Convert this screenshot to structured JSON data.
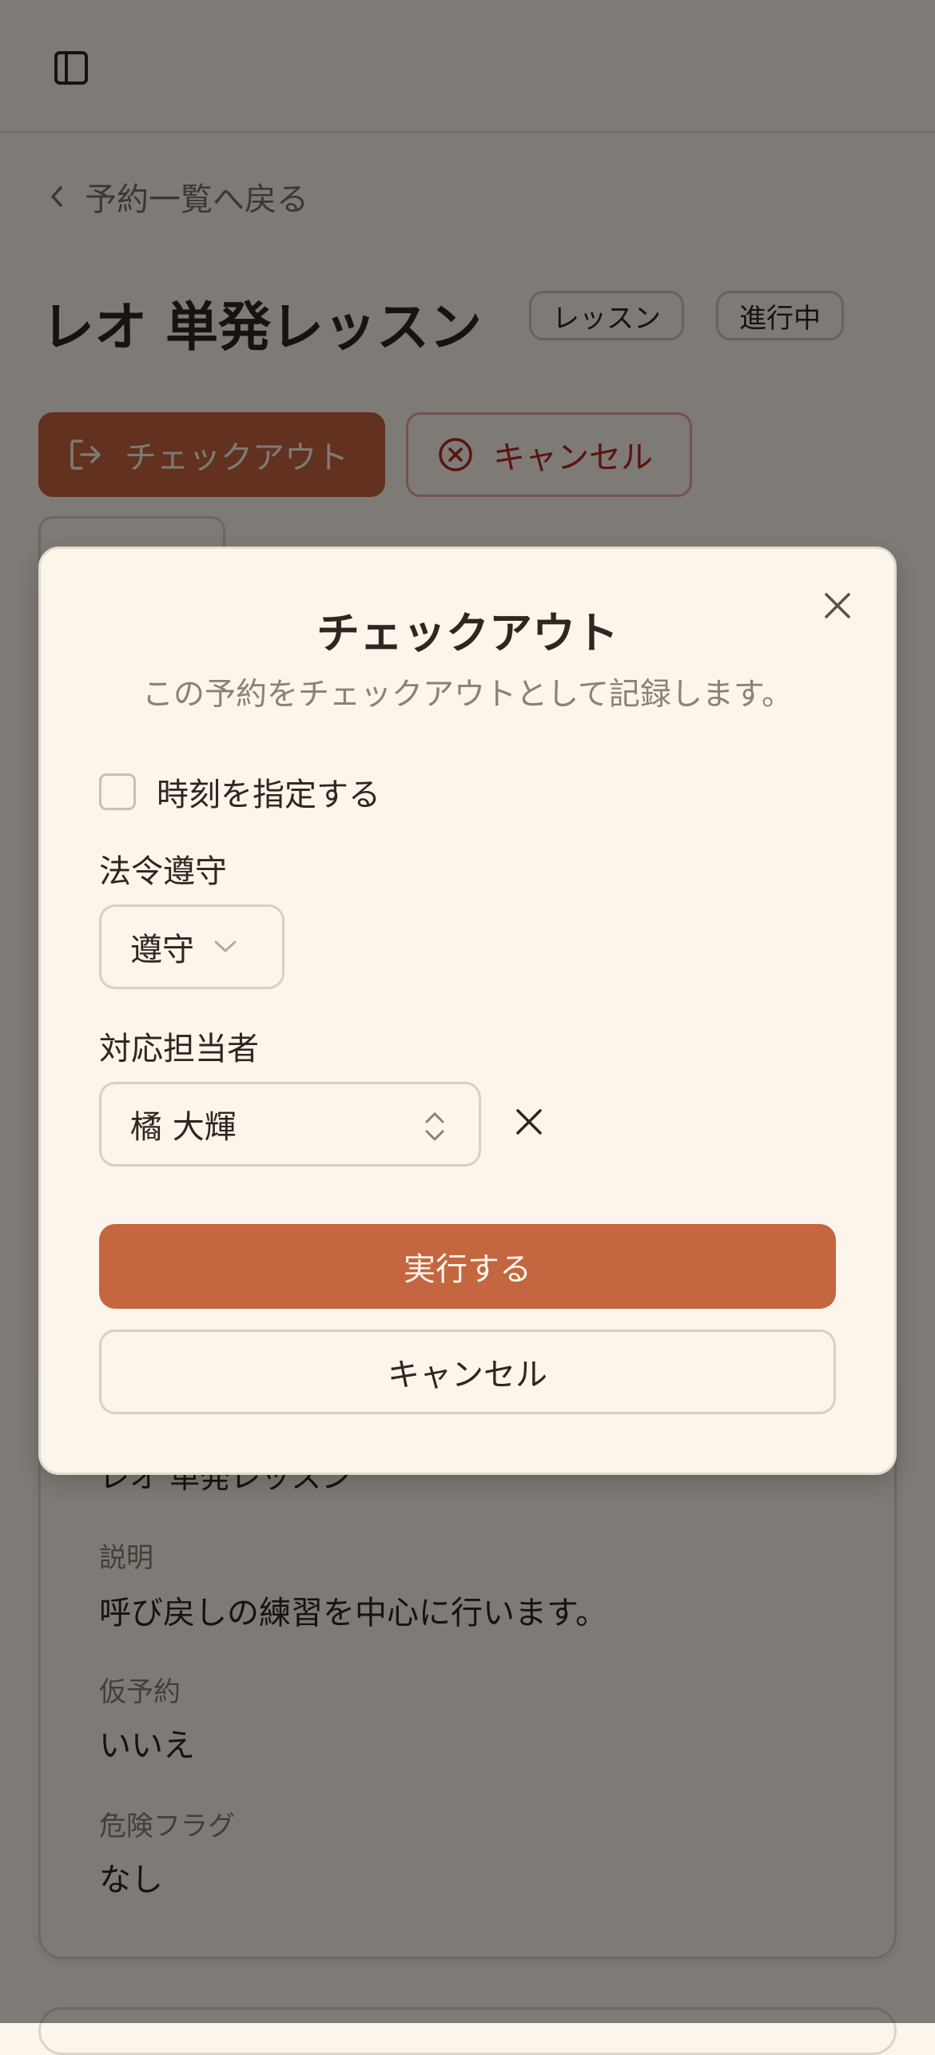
{
  "header": {
    "sidebar_toggle_icon": "sidebar-panel-icon"
  },
  "back_link": {
    "label": "予約一覧へ戻る",
    "icon": "chevron-left-icon"
  },
  "page": {
    "title": "レオ 単発レッスン",
    "badges": [
      "レッスン",
      "進行中"
    ]
  },
  "actions": {
    "checkout_label": "チェックアウト",
    "cancel_label": "キャンセル"
  },
  "details": {
    "title_value_partial": "レオ 単発レッスン",
    "description_label": "説明",
    "description_value": "呼び戻しの練習を中心に行います。",
    "tentative_label": "仮予約",
    "tentative_value": "いいえ",
    "danger_flag_label": "危険フラグ",
    "danger_flag_value": "なし"
  },
  "modal": {
    "title": "チェックアウト",
    "description": "この予約をチェックアウトとして記録します。",
    "specify_time_label": "時刻を指定する",
    "specify_time_checked": false,
    "compliance_label": "法令遵守",
    "compliance_value": "遵守",
    "staff_label": "対応担当者",
    "staff_value": "橘 大輝",
    "submit_label": "実行する",
    "cancel_label": "キャンセル"
  },
  "colors": {
    "background": "#fcf5ec",
    "accent": "#c4663f",
    "danger": "#b3261e",
    "text": "#2f261f",
    "muted": "#8d8075"
  }
}
